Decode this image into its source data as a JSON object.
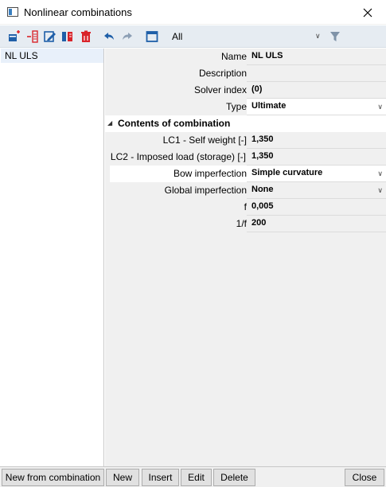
{
  "window": {
    "title": "Nonlinear combinations"
  },
  "toolbar": {
    "filter_label": "All"
  },
  "list": {
    "items": [
      "NL ULS"
    ]
  },
  "properties": {
    "name_label": "Name",
    "name_value": "NL ULS",
    "description_label": "Description",
    "description_value": "",
    "solver_label": "Solver index",
    "solver_value": "(0)",
    "type_label": "Type",
    "type_value": "Ultimate",
    "section_label": "Contents of combination",
    "lc1_label": "LC1 - Self weight [-]",
    "lc1_value": "1,350",
    "lc2_label": "LC2 - Imposed load (storage) [-]",
    "lc2_value": "1,350",
    "bow_label": "Bow imperfection",
    "bow_value": "Simple curvature",
    "global_label": "Global imperfection",
    "global_value": "None",
    "f_label": "f",
    "f_value": "0,005",
    "inv_f_label": "1/f",
    "inv_f_value": "200"
  },
  "buttons": {
    "new_from_combination": "New from combination",
    "new": "New",
    "insert": "Insert",
    "edit": "Edit",
    "delete": "Delete",
    "close": "Close"
  },
  "colors": {
    "accent_blue": "#1f5fa8",
    "red": "#d9242a",
    "toolbar_bg": "#e6ecf2"
  }
}
